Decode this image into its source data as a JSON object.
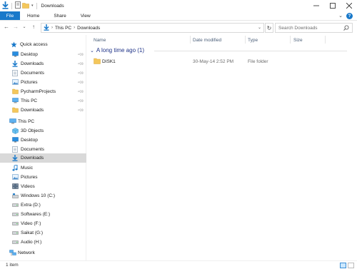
{
  "window": {
    "title": "Downloads"
  },
  "colors": {
    "accent": "#1979ca",
    "selected": "#cce8ff",
    "group": "#1e3287"
  },
  "ribbon": {
    "tabs": [
      "File",
      "Home",
      "Share",
      "View"
    ]
  },
  "address": {
    "crumbs": [
      "This PC",
      "Downloads"
    ],
    "search_placeholder": "Search Downloads"
  },
  "nav": {
    "quick_access": "Quick access",
    "quick_items": [
      {
        "label": "Desktop",
        "icon": "desktop-icon"
      },
      {
        "label": "Downloads",
        "icon": "downloads-icon"
      },
      {
        "label": "Documents",
        "icon": "documents-icon"
      },
      {
        "label": "Pictures",
        "icon": "pictures-icon"
      },
      {
        "label": "PycharmProjects",
        "icon": "folder-icon"
      },
      {
        "label": "This PC",
        "icon": "this-pc-icon"
      },
      {
        "label": "Downloads",
        "icon": "folder-icon"
      }
    ],
    "this_pc": "This PC",
    "pc_items": [
      {
        "label": "3D Objects",
        "icon": "3d-objects-icon"
      },
      {
        "label": "Desktop",
        "icon": "desktop-icon"
      },
      {
        "label": "Documents",
        "icon": "documents-icon"
      },
      {
        "label": "Downloads",
        "icon": "downloads-icon"
      },
      {
        "label": "Music",
        "icon": "music-icon"
      },
      {
        "label": "Pictures",
        "icon": "pictures-icon"
      },
      {
        "label": "Videos",
        "icon": "videos-icon"
      },
      {
        "label": "Windows 10 (C:)",
        "icon": "windows-drive-icon"
      },
      {
        "label": "Extra (D:)",
        "icon": "drive-icon"
      },
      {
        "label": "Softwares (E:)",
        "icon": "drive-icon"
      },
      {
        "label": "Video (F:)",
        "icon": "drive-icon"
      },
      {
        "label": "Saikat (G:)",
        "icon": "drive-icon"
      },
      {
        "label": "Audio (H:)",
        "icon": "drive-icon"
      }
    ],
    "network": "Network"
  },
  "content": {
    "columns": [
      "Name",
      "Date modified",
      "Type",
      "Size"
    ],
    "group_label": "A long time ago (1)",
    "rows": [
      {
        "name": "DISK1",
        "date": "30-May-14 2:52 PM",
        "type": "File folder",
        "size": ""
      }
    ]
  },
  "status": {
    "count": "1 item"
  }
}
